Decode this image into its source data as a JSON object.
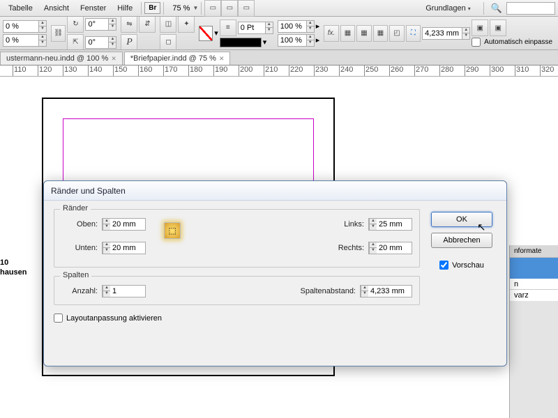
{
  "menu": {
    "tabelle": "Tabelle",
    "ansicht": "Ansicht",
    "fenster": "Fenster",
    "hilfe": "Hilfe",
    "br": "Br",
    "zoom": "75 %",
    "grundlagen": "Grundlagen"
  },
  "toolbar": {
    "pct0a": "0 %",
    "pct0b": "0 %",
    "deg0a": "0°",
    "deg0b": "0°",
    "pt0": "0 Pt",
    "pct100a": "100 %",
    "pct100b": "100 %",
    "dim": "4,233 mm",
    "autofit": "Automatisch einpasse"
  },
  "tabs": {
    "t1": "ustermann-neu.indd @ 100 %",
    "t2": "*Briefpapier.indd @ 75 %"
  },
  "ruler": {
    "ticks": [
      "110",
      "120",
      "130",
      "140",
      "150",
      "160",
      "170",
      "180",
      "190",
      "200",
      "210",
      "220",
      "230",
      "240",
      "250",
      "260",
      "270",
      "280",
      "290",
      "300",
      "310",
      "320"
    ]
  },
  "sidebar": {
    "p1": "nformate",
    "p2": "n",
    "p3": "varz"
  },
  "leftinfo": {
    "l1": "10",
    "l2": "hausen"
  },
  "dialog": {
    "title": "Ränder und Spalten",
    "group_margins": "Ränder",
    "oben": "Oben:",
    "unten": "Unten:",
    "links": "Links:",
    "rechts": "Rechts:",
    "val_oben": "20 mm",
    "val_unten": "20 mm",
    "val_links": "25 mm",
    "val_rechts": "20 mm",
    "group_cols": "Spalten",
    "anzahl": "Anzahl:",
    "val_anzahl": "1",
    "spaltenabstand": "Spaltenabstand:",
    "val_spaltenabstand": "4,233 mm",
    "layoutopt": "Layoutanpassung aktivieren",
    "ok": "OK",
    "abbrechen": "Abbrechen",
    "vorschau": "Vorschau"
  }
}
